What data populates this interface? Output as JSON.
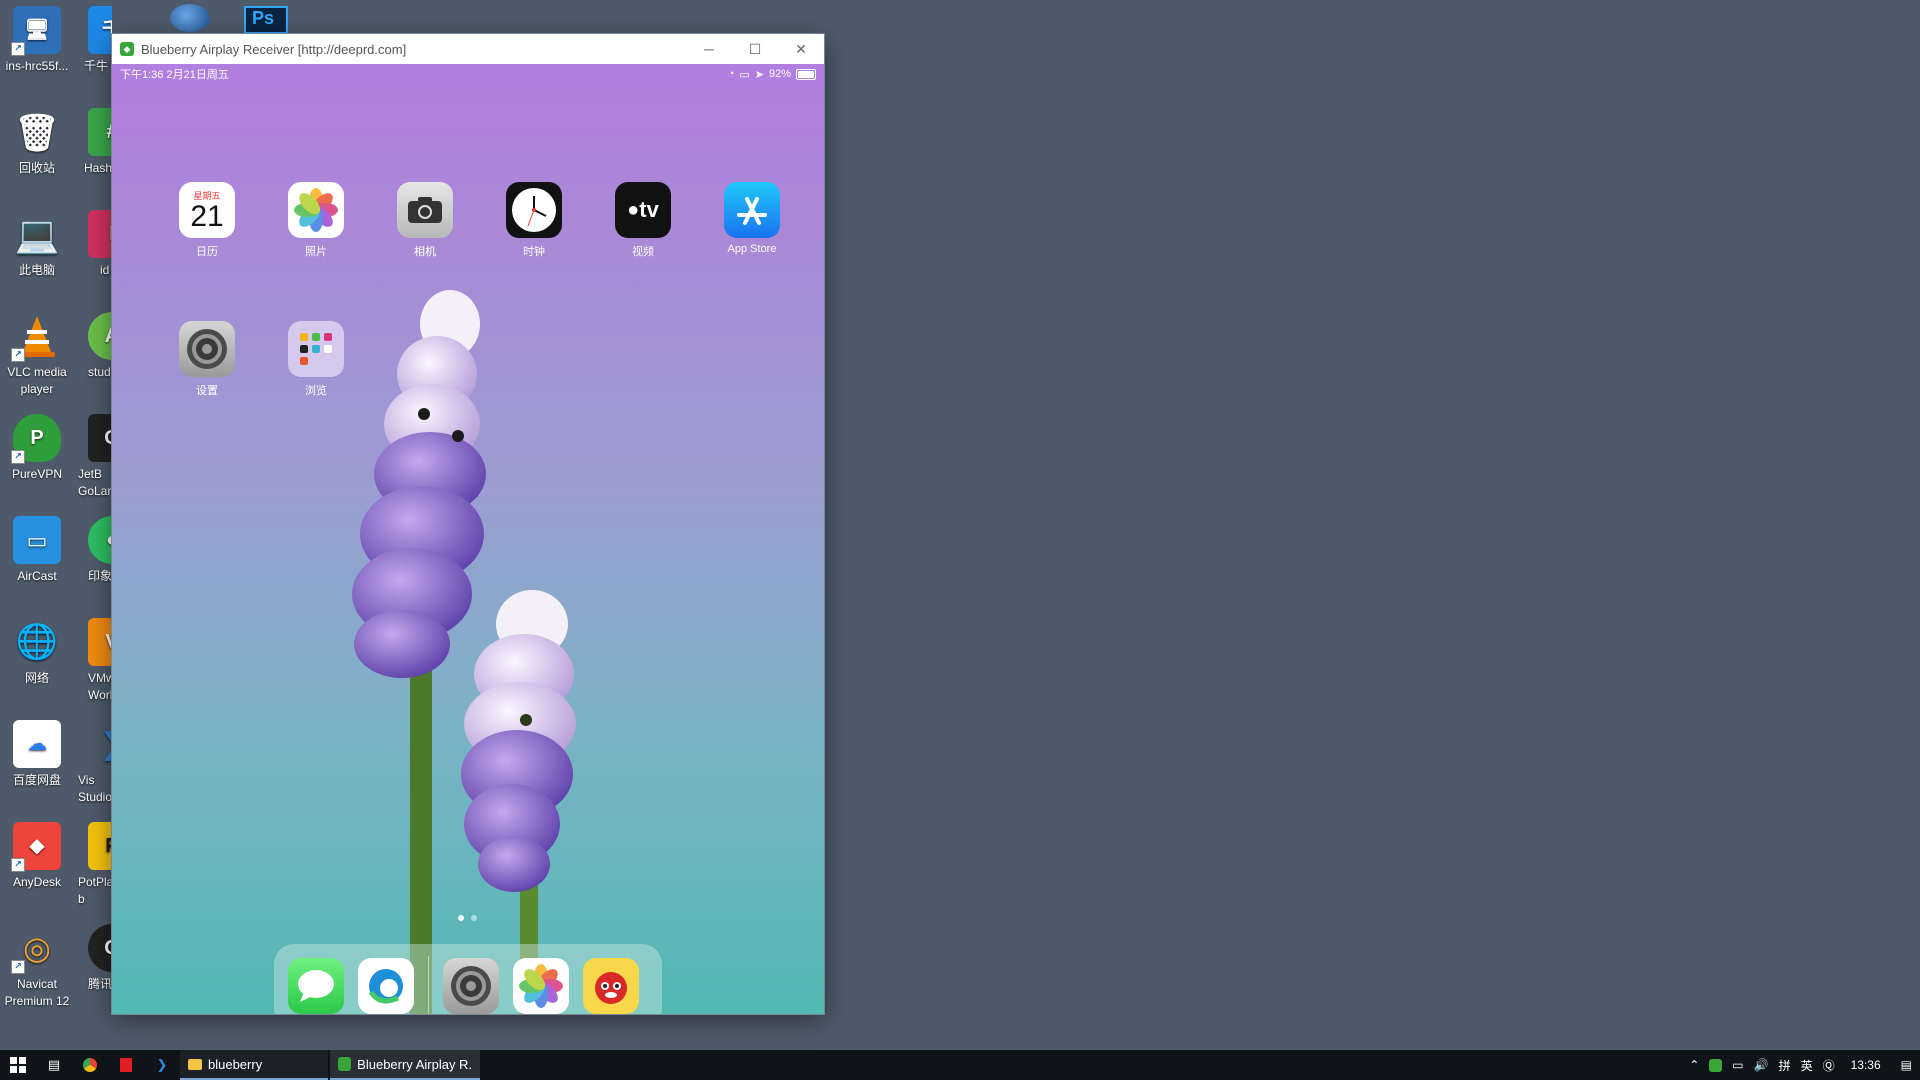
{
  "desktop_icons": [
    {
      "label": "ins-hrc55f...",
      "icon": "computer-icon",
      "color": "#2d6fb8"
    },
    {
      "label": "回收站",
      "icon": "recycle-bin-icon",
      "color": "#8aa0b8"
    },
    {
      "label": "此电脑",
      "icon": "this-pc-icon",
      "color": "#3b8fd8"
    },
    {
      "label": "VLC media player",
      "icon": "vlc-icon",
      "color": "#f08a00"
    },
    {
      "label": "PureVPN",
      "icon": "purevpn-icon",
      "color": "#2e9e3a"
    },
    {
      "label": "AirCast",
      "icon": "aircast-icon",
      "color": "#2790e0"
    },
    {
      "label": "网络",
      "icon": "network-icon",
      "color": "#3a87c8"
    },
    {
      "label": "百度网盘",
      "icon": "baidu-netdisk-icon",
      "color": "#ffffff"
    },
    {
      "label": "AnyDesk",
      "icon": "anydesk-icon",
      "color": "#ef443b"
    },
    {
      "label": "Navicat Premium 12",
      "icon": "navicat-icon",
      "color": "#3a7fb4"
    }
  ],
  "desktop_icons_col2": [
    {
      "label": "千牛",
      "icon": "qianniu-icon",
      "color": "#1e88e5"
    },
    {
      "label": "Hash",
      "icon": "hash-icon",
      "color": "#3aa64a"
    },
    {
      "label": "id",
      "icon": "idea-icon",
      "color": "#d03060"
    },
    {
      "label": "stud",
      "icon": "studio-icon",
      "color": "#6cbf4a"
    },
    {
      "label": "JetB GoLar",
      "icon": "goland-icon",
      "color": "#222222"
    },
    {
      "label": "印象",
      "icon": "evernote-icon",
      "color": "#2dbe60"
    },
    {
      "label": "VMw Work",
      "icon": "vmware-icon",
      "color": "#f08a10"
    },
    {
      "label": "Vis Studio",
      "icon": "vscode-icon",
      "color": "#2b7bd0"
    },
    {
      "label": "PotPla b",
      "icon": "potplayer-icon",
      "color": "#f4c20d"
    },
    {
      "label": "腾讯",
      "icon": "tencent-icon",
      "color": "#222222"
    }
  ],
  "window": {
    "title": "Blueberry Airplay Receiver [http://deeprd.com]",
    "minimize": "─",
    "maximize": "☐",
    "close": "✕"
  },
  "ipad": {
    "status_left": "下午1:36   2月21日周五",
    "status_right": "92%",
    "apps_row1": [
      {
        "label": "日历",
        "icon": "calendar-icon",
        "day": "星期五",
        "date": "21"
      },
      {
        "label": "照片",
        "icon": "photos-icon"
      },
      {
        "label": "相机",
        "icon": "camera-icon"
      },
      {
        "label": "时钟",
        "icon": "clock-icon"
      },
      {
        "label": "视频",
        "icon": "apple-tv-icon",
        "tv_text": "tv"
      },
      {
        "label": "App Store",
        "icon": "app-store-icon"
      }
    ],
    "apps_row2": [
      {
        "label": "设置",
        "icon": "settings-icon"
      },
      {
        "label": "浏览",
        "icon": "folder-icon"
      }
    ],
    "dock": [
      {
        "icon": "messages-icon"
      },
      {
        "icon": "edge-icon"
      },
      {
        "icon": "settings-icon"
      },
      {
        "icon": "photos-icon"
      },
      {
        "icon": "game-icon"
      }
    ]
  },
  "taskbar": {
    "apps": [
      {
        "label": "blueberry",
        "icon": "folder-icon"
      },
      {
        "label": "Blueberry Airplay R...",
        "icon": "airplay-icon"
      }
    ],
    "ime": "英",
    "time": "13:36"
  }
}
